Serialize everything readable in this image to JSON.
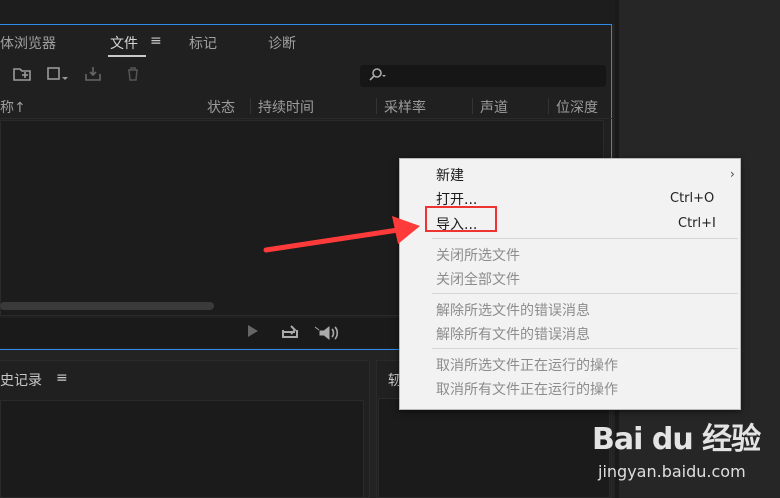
{
  "files_panel": {
    "tabs": [
      {
        "label": "体浏览器"
      },
      {
        "label": "文件",
        "active": true
      },
      {
        "label": "标记"
      },
      {
        "label": "诊断"
      }
    ],
    "tab_menu_icon": "≡",
    "search_icon": "search-icon",
    "columns": [
      "称",
      "状态",
      "持续时间",
      "采样率",
      "声道",
      "位深度"
    ],
    "sort_indicator": "↑"
  },
  "history_panel": {
    "title": "史记录",
    "menu_icon": "≡"
  },
  "right_panel": {
    "title": "轫"
  },
  "context_menu": {
    "items": [
      {
        "label": "新建",
        "has_submenu": true,
        "enabled": true
      },
      {
        "label": "打开...",
        "shortcut": "Ctrl+O",
        "enabled": true
      },
      {
        "label": "导入...",
        "shortcut": "Ctrl+I",
        "enabled": true,
        "highlighted": true
      },
      {
        "label": "关闭所选文件",
        "enabled": false
      },
      {
        "label": "关闭全部文件",
        "enabled": false
      },
      {
        "label": "解除所选文件的错误消息",
        "enabled": false
      },
      {
        "label": "解除所有文件的错误消息",
        "enabled": false
      },
      {
        "label": "取消所选文件正在运行的操作",
        "enabled": false
      },
      {
        "label": "取消所有文件正在运行的操作",
        "enabled": false
      }
    ]
  },
  "annotation": {
    "highlight_color": "#ee3333",
    "arrow_color": "#ff3a3a"
  },
  "watermark": {
    "logo": "Bai du 经验",
    "url": "jingyan.baidu.com"
  },
  "colors": {
    "accent_border": "#2d8ceb",
    "menu_bg": "#f2f2f2",
    "app_bg": "#232323"
  }
}
